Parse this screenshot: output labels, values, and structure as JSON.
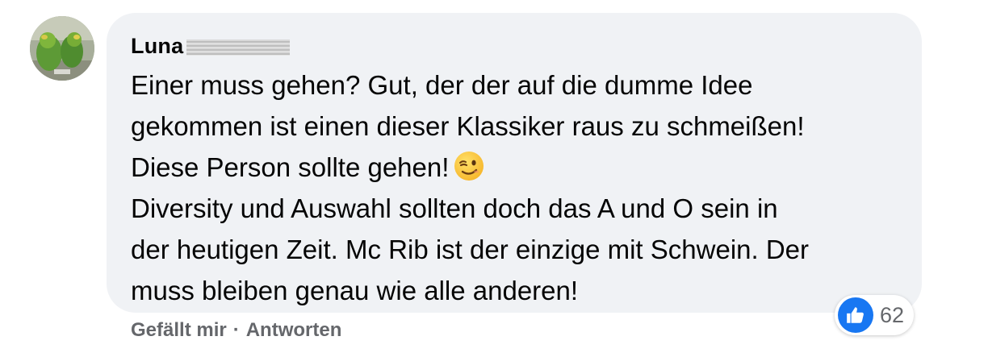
{
  "comment": {
    "author_name": "Luna",
    "lines": [
      "Einer muss gehen? Gut, der der auf die dumme Idee",
      "gekommen ist einen dieser Klassiker raus zu schmeißen!",
      "Diese Person sollte gehen!",
      "Diversity und Auswahl sollten doch das A und O sein in",
      "der heutigen Zeit. Mc Rib ist der einzige mit Schwein. Der",
      "muss bleiben genau wie alle anderen!"
    ],
    "emoji": "winking-face-icon"
  },
  "reactions": {
    "icon": "like-icon",
    "count": "62",
    "color": "#1877f2"
  },
  "actions": {
    "like_label": "Gefällt mir",
    "separator": "·",
    "reply_label": "Antworten"
  },
  "colors": {
    "bubble": "#f0f2f5",
    "text": "#050505",
    "secondary": "#65676b"
  }
}
